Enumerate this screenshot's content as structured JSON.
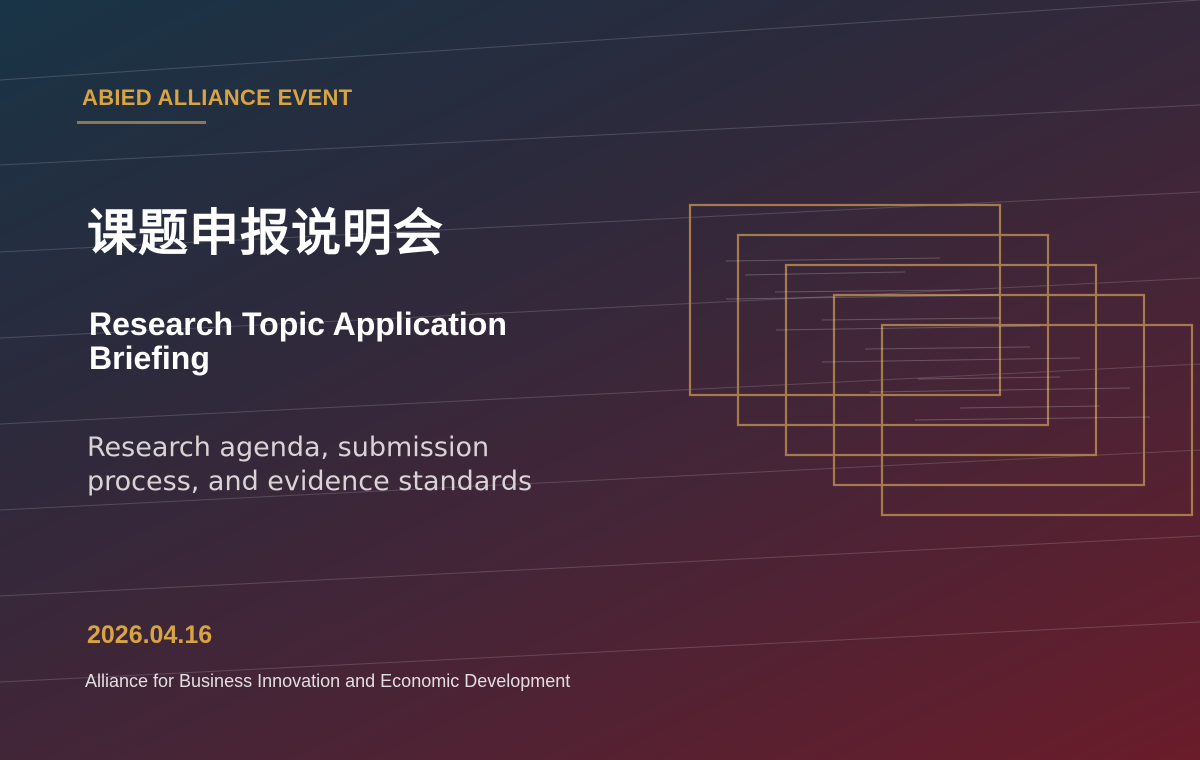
{
  "slide": {
    "eyebrow": "ABIED ALLIANCE EVENT",
    "title_zh": "课题申报说明会",
    "title_en": "Research Topic Application Briefing",
    "subtitle": "Research agenda, submission process, and evidence standards",
    "date": "2026.04.16",
    "organization": "Alliance for Business Innovation and Economic Development"
  },
  "colors": {
    "accent_gold": "#d8a441",
    "frame_gold": "#a77a4c",
    "background_start": "#183446",
    "background_end": "#6a1c2a"
  }
}
